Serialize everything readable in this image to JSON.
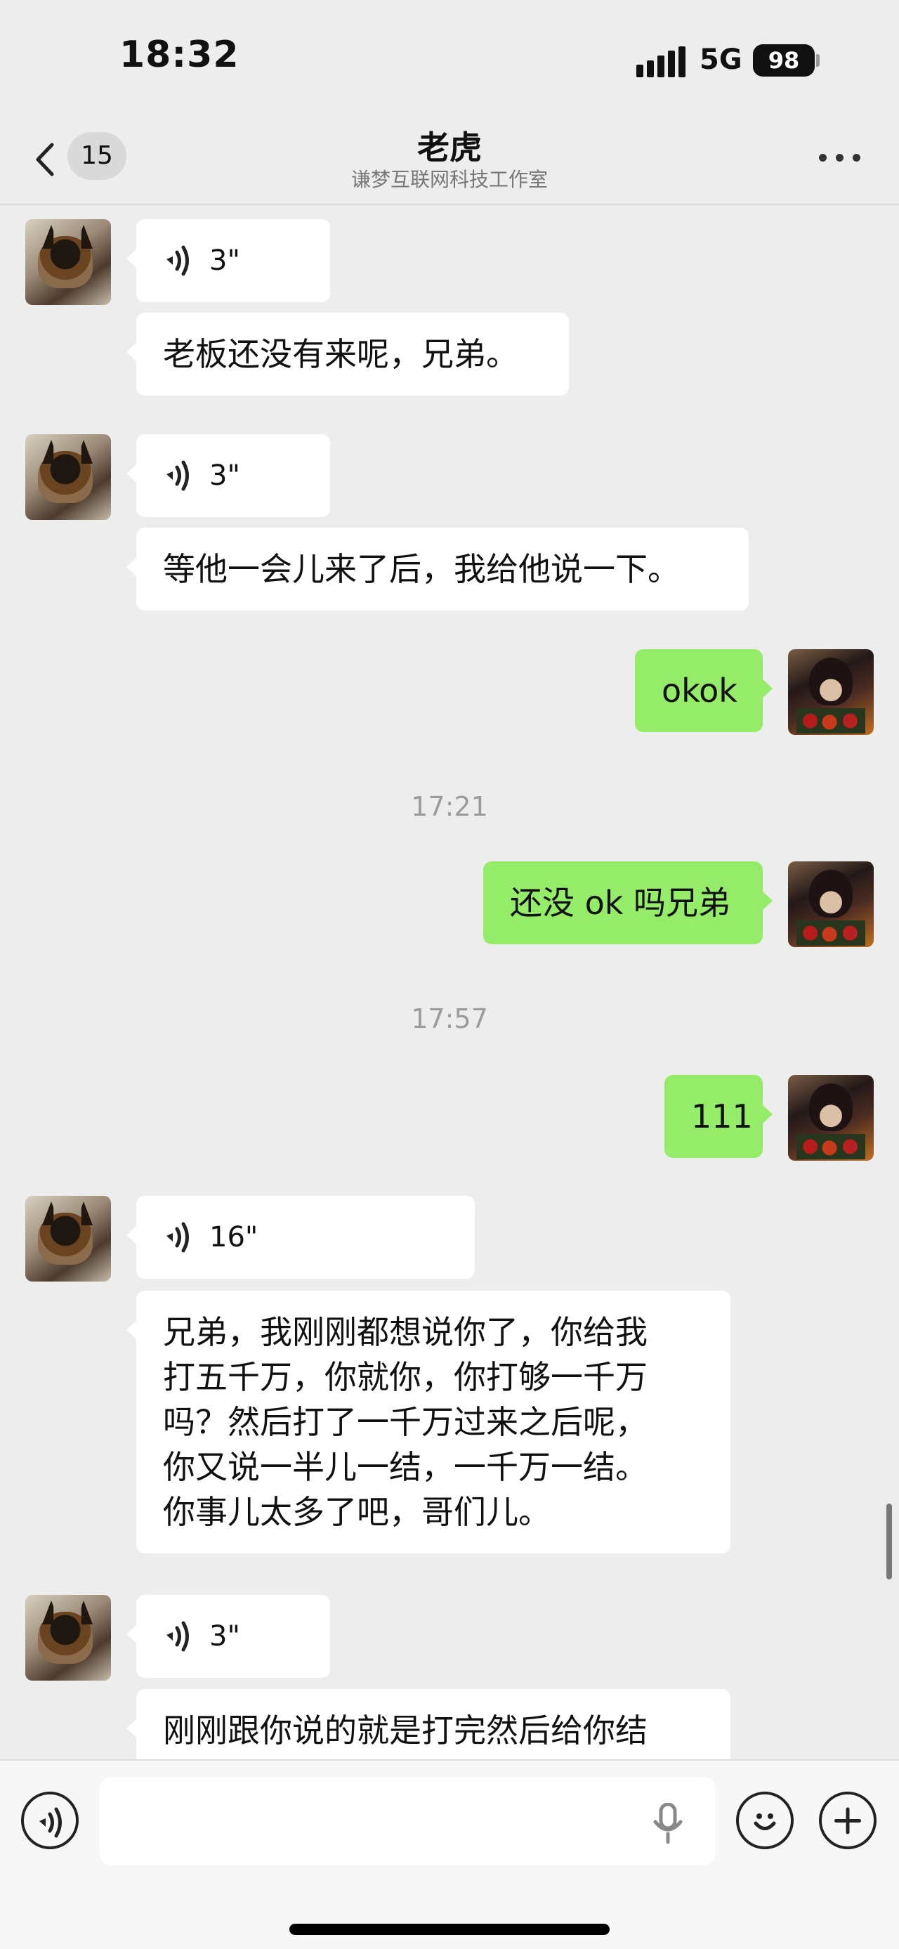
{
  "status_bar": {
    "time": "18:32",
    "network": "5G",
    "battery": "98"
  },
  "header": {
    "back_count": "15",
    "title": "老虎",
    "subtitle": "谦梦互联网科技工作室"
  },
  "messages": [
    {
      "type": "voice",
      "direction": "incoming",
      "duration": "3\""
    },
    {
      "type": "text",
      "direction": "incoming",
      "lines": [
        "老板还没有来呢，兄弟。"
      ]
    },
    {
      "type": "voice",
      "direction": "incoming",
      "duration": "3\""
    },
    {
      "type": "text",
      "direction": "incoming",
      "lines": [
        "等他一会儿来了后，我给他说一下。"
      ]
    },
    {
      "type": "text",
      "direction": "outgoing",
      "lines": [
        "okok"
      ]
    },
    {
      "type": "time",
      "value": "17:21"
    },
    {
      "type": "text",
      "direction": "outgoing",
      "lines": [
        "还没 ok 吗兄弟"
      ]
    },
    {
      "type": "time",
      "value": "17:57"
    },
    {
      "type": "text",
      "direction": "outgoing",
      "lines": [
        "111"
      ]
    },
    {
      "type": "voice",
      "direction": "incoming",
      "duration": "16\""
    },
    {
      "type": "text",
      "direction": "incoming",
      "lines": [
        "兄弟，我刚刚都想说你了，你给我",
        "打五千万，你就你，你打够一千万",
        "吗？然后打了一千万过来之后呢，",
        "你又说一半儿一结，一千万一结。",
        "你事儿太多了吧，哥们儿。"
      ]
    },
    {
      "type": "voice",
      "direction": "incoming",
      "duration": "3\""
    },
    {
      "type": "text",
      "direction": "incoming",
      "lines": [
        "刚刚跟你说的就是打完然后给你结"
      ]
    }
  ],
  "composer": {
    "value": ""
  },
  "colors": {
    "background": "#ededed",
    "outgoing_bubble": "#95ec69",
    "incoming_bubble": "#ffffff"
  }
}
